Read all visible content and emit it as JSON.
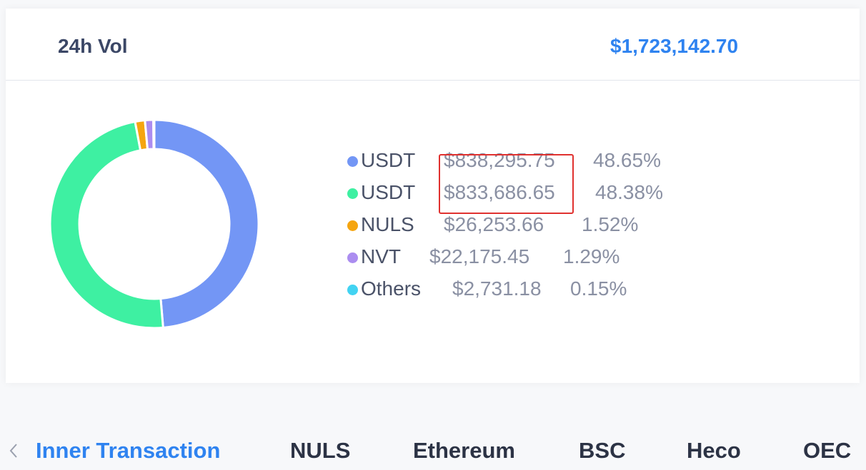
{
  "header": {
    "label": "24h Vol",
    "value": "$1,723,142.70"
  },
  "chart_data": {
    "type": "pie",
    "donut": true,
    "categories": [
      "USDT",
      "USDT",
      "NULS",
      "NVT",
      "Others"
    ],
    "values": [
      48.65,
      48.38,
      1.52,
      1.29,
      0.15
    ],
    "colors": [
      "#7396f5",
      "#3ef0a2",
      "#f5a510",
      "#ab8df0",
      "#42d3f2"
    ]
  },
  "legend": {
    "items": [
      {
        "token": "USDT",
        "amount": "$838,295.75",
        "percent": "48.65%",
        "color": "#7396f5"
      },
      {
        "token": "USDT",
        "amount": "$833,686.65",
        "percent": "48.38%",
        "color": "#3ef0a2"
      },
      {
        "token": "NULS",
        "amount": "$26,253.66",
        "percent": "1.52%",
        "color": "#f5a510"
      },
      {
        "token": "NVT",
        "amount": "$22,175.45",
        "percent": "1.29%",
        "color": "#ab8df0"
      },
      {
        "token": "Others",
        "amount": "$2,731.18",
        "percent": "0.15%",
        "color": "#42d3f2"
      }
    ]
  },
  "highlight_color": "#e0312f",
  "tabs": {
    "prev_icon": "chevron-left-icon",
    "items": [
      {
        "label": "Inner Transaction",
        "active": true
      },
      {
        "label": "NULS",
        "active": false
      },
      {
        "label": "Ethereum",
        "active": false
      },
      {
        "label": "BSC",
        "active": false
      },
      {
        "label": "Heco",
        "active": false
      },
      {
        "label": "OEC",
        "active": false
      }
    ]
  }
}
